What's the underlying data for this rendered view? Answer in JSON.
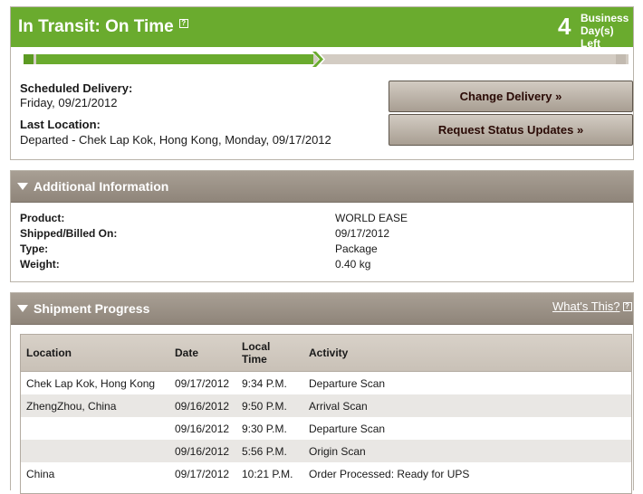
{
  "colors": {
    "status_green": "#6aab2e",
    "section_header": "#9a9086",
    "button_text": "#2a0a05"
  },
  "status": {
    "title": "In Transit: On Time",
    "help_icon_glyph": "?",
    "days_number": "4",
    "days_label_line1": "Business",
    "days_label_line2": "Day(s) Left",
    "progress_fraction": 0.47,
    "scheduled_label": "Scheduled Delivery:",
    "scheduled_value": "Friday, 09/21/2012",
    "last_location_label": "Last Location:",
    "last_location_value": "Departed - Chek Lap Kok, Hong Kong, Monday, 09/17/2012",
    "change_delivery_button": "Change Delivery »",
    "request_updates_button": "Request Status Updates »"
  },
  "additional": {
    "title": "Additional Information",
    "rows": [
      {
        "label": "Product:",
        "value": "WORLD EASE"
      },
      {
        "label": "Shipped/Billed On:",
        "value": "09/17/2012"
      },
      {
        "label": "Type:",
        "value": "Package"
      },
      {
        "label": "Weight:",
        "value": "0.40 kg"
      }
    ]
  },
  "shipment": {
    "title": "Shipment Progress",
    "whats_this": "What's This?",
    "columns": {
      "location": "Location",
      "date": "Date",
      "local_time_line1": "Local",
      "local_time_line2": "Time",
      "activity": "Activity"
    },
    "rows": [
      {
        "location": "Chek Lap Kok, Hong Kong",
        "date": "09/17/2012",
        "time": "9:34 P.M.",
        "activity": "Departure Scan"
      },
      {
        "location": "ZhengZhou, China",
        "date": "09/16/2012",
        "time": "9:50 P.M.",
        "activity": "Arrival Scan"
      },
      {
        "location": "",
        "date": "09/16/2012",
        "time": "9:30 P.M.",
        "activity": "Departure Scan"
      },
      {
        "location": "",
        "date": "09/16/2012",
        "time": "5:56 P.M.",
        "activity": "Origin Scan"
      },
      {
        "location": "China",
        "date": "09/17/2012",
        "time": "10:21 P.M.",
        "activity": "Order Processed: Ready for UPS"
      }
    ]
  }
}
